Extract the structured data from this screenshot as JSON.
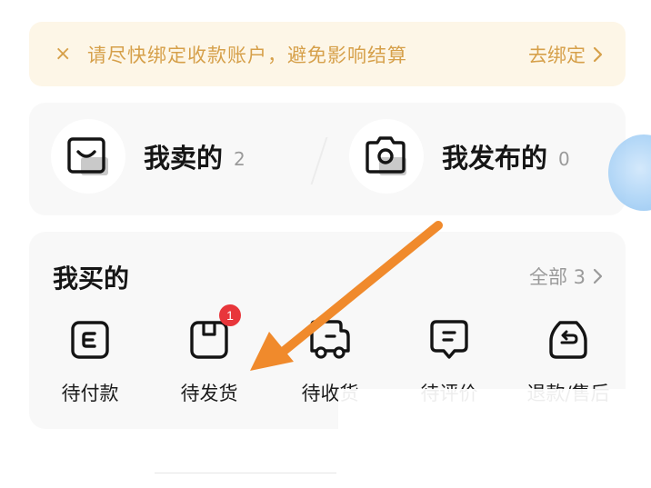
{
  "notice": {
    "close_glyph": "×",
    "message": "请尽快绑定收款账户，避免影响结算",
    "action": "去绑定"
  },
  "sell_section": {
    "sold": {
      "label": "我卖的",
      "count": "2"
    },
    "published": {
      "label": "我发布的",
      "count": "0"
    }
  },
  "buy_section": {
    "title": "我买的",
    "all_label": "全部 3",
    "orders": [
      {
        "label": "待付款",
        "icon": "wallet-icon"
      },
      {
        "label": "待发货",
        "icon": "package-icon",
        "badge": "1"
      },
      {
        "label": "待收货",
        "icon": "truck-icon"
      },
      {
        "label": "待评价",
        "icon": "comment-icon"
      },
      {
        "label": "退款/售后",
        "icon": "refund-icon"
      }
    ]
  },
  "colors": {
    "notice_bg": "#fdf6e7",
    "notice_text": "#d6a04a",
    "badge": "#e8363b",
    "arrow": "#f08a2c"
  }
}
